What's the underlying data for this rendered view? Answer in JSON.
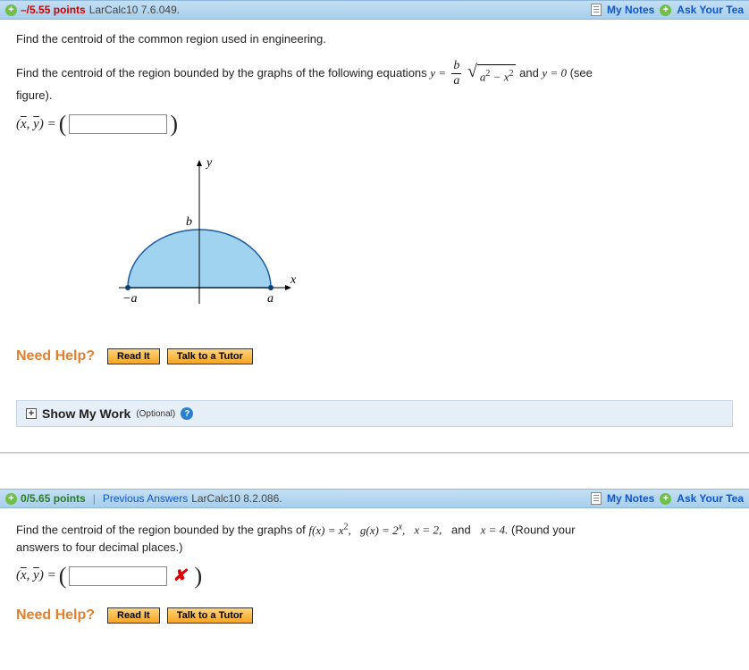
{
  "q1": {
    "header": {
      "points": "–/5.55 points",
      "ref": "LarCalc10 7.6.049.",
      "my_notes": "My Notes",
      "ask": "Ask Your Tea"
    },
    "prompt1": "Find the centroid of the common region used in engineering.",
    "prompt2a": "Find the centroid of the region bounded by the graphs of the following equations  ",
    "eq_y_eq": "y = ",
    "frac_b": "b",
    "frac_a": "a",
    "rad_a2": "a",
    "rad_minus": " − ",
    "rad_x2": "x",
    "prompt2b": "  and  ",
    "eq_y0": "y = 0",
    "prompt2c": "  (see",
    "prompt3": "figure).",
    "answer_label_x": "x",
    "answer_label_y": "y",
    "need_help": "Need Help?",
    "read_it": "Read It",
    "tutor": "Talk to a Tutor",
    "smw": "Show My Work",
    "smw_opt": "(Optional)"
  },
  "q2": {
    "header": {
      "points": "0/5.65 points",
      "prev": "Previous Answers",
      "ref": "LarCalc10 8.2.086.",
      "my_notes": "My Notes",
      "ask": "Ask Your Tea"
    },
    "prompt_a": "Find the centroid of the region bounded by the graphs of  ",
    "fx": "f(x) = x",
    "gx": "g(x) = 2",
    "x2": "x = 2,",
    "x4": "x = 4.",
    "round": "  (Round your",
    "prompt_b": "answers to four decimal places.)",
    "answer_label_x": "x",
    "answer_label_y": "y",
    "need_help": "Need Help?",
    "read_it": "Read It",
    "tutor": "Talk to a Tutor"
  },
  "chart_data": {
    "type": "area",
    "description": "Upper half of an ellipse centered at origin",
    "x_range": [
      -1,
      1
    ],
    "x_tick_labels": [
      "−a",
      "a"
    ],
    "y_tick_labels": [
      "b"
    ],
    "x_axis_label": "x",
    "y_axis_label": "y",
    "equation_upper": "y = (b/a) * sqrt(a^2 - x^2)",
    "equation_lower": "y = 0",
    "fill_color": "#9fd3f0",
    "stroke_color": "#1a5aa0"
  }
}
